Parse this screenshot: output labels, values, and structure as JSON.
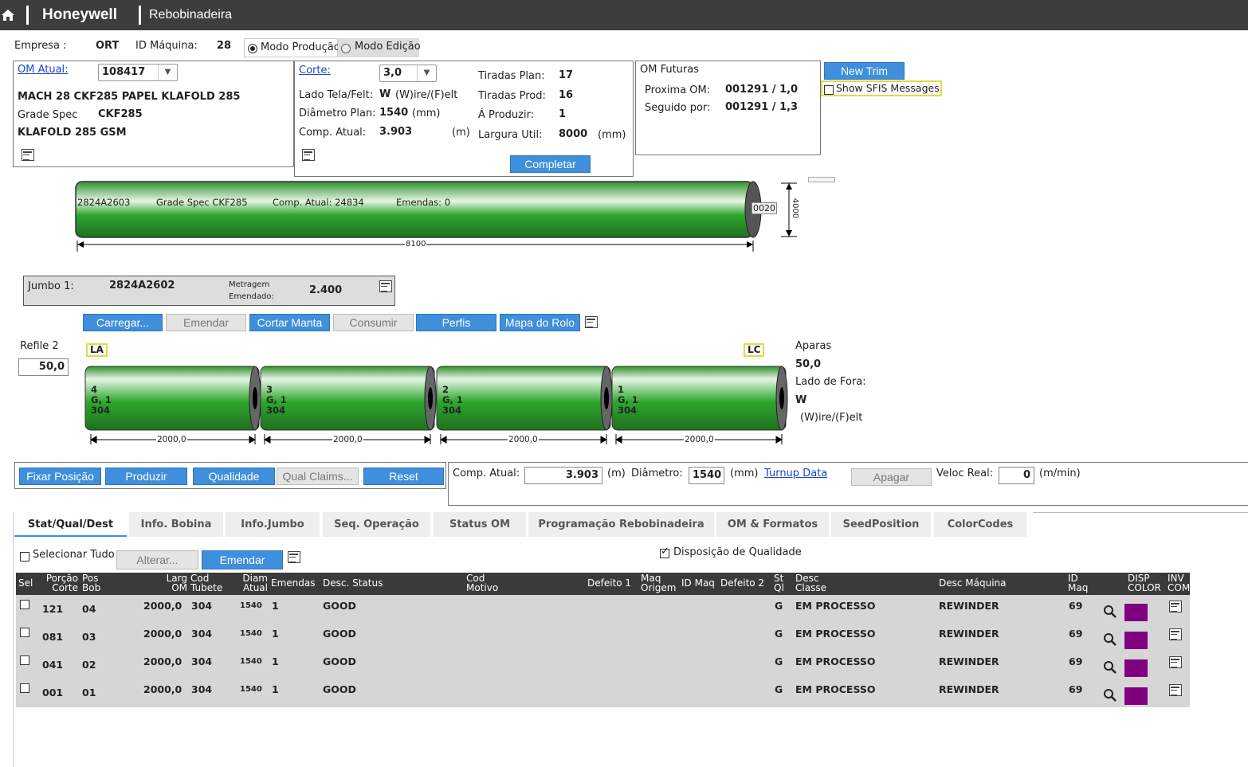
{
  "header": {
    "brand": "Honeywell",
    "app": "Rebobinadeira"
  },
  "info": {
    "empresa_label": "Empresa :",
    "empresa": "ORT",
    "maquina_label": "ID Máquina:",
    "maquina": "28",
    "modo_producao": "Modo Produção",
    "modo_edicao": "Modo Edição"
  },
  "om": {
    "label": "OM Atual:",
    "value": "108417",
    "line1": "MACH 28 CKF285 PAPEL KLAFOLD 285",
    "grade_label": "Grade Spec",
    "grade": "CKF285",
    "line3": "KLAFOLD 285 GSM"
  },
  "corte": {
    "label": "Corte:",
    "value": "3,0",
    "lado_label": "Lado Tela/Felt:",
    "lado": "W",
    "lado_hint": "(W)ire/(F)elt",
    "diam_label": "Diâmetro Plan:",
    "diam": "1540",
    "diam_unit": "(mm)",
    "comp_label": "Comp. Atual:",
    "comp": "3.903",
    "comp_unit": "(m)",
    "tir_plan_label": "Tiradas Plan:",
    "tir_plan": "17",
    "tir_prod_label": "Tiradas Prod:",
    "tir_prod": "16",
    "aprod_label": "Á Produzir:",
    "aprod": "1",
    "larg_label": "Largura Util:",
    "larg": "8000",
    "larg_unit": "(mm)",
    "completar": "Completar"
  },
  "futuras": {
    "title": "OM Futuras",
    "prox_label": "Proxima OM:",
    "prox": "001291 / 1,0",
    "seg_label": "Seguido por:",
    "seg": "001291 / 1,3"
  },
  "newtrim": "New Trim",
  "sfis": "Show SFIS Messages",
  "jumbo_roll": {
    "id": "2824A2603",
    "grade": "Grade Spec CKF285",
    "comp": "Comp. Atual: 24834",
    "emendas": "Emendas:  0",
    "end": "0020",
    "width": "8100",
    "height": "4000"
  },
  "jumbo1": {
    "label": "Jumbo 1:",
    "value": "2824A2602",
    "metragem": "Metragem",
    "emendado": "Emendado:",
    "mval": "2.400"
  },
  "actions": [
    "Carregar...",
    "Emendar",
    "Cortar Manta",
    "Consumir",
    "Perfis",
    "Mapa do Rolo"
  ],
  "refile": {
    "label": "Refile 2",
    "value": "50,0",
    "la": "LA",
    "lc": "LC"
  },
  "aparas": {
    "label": "Aparas",
    "value": "50,0",
    "lado_label": "Lado de Fora:",
    "lado": "W",
    "hint": "(W)ire/(F)elt"
  },
  "rolls": [
    {
      "n": "4",
      "g": "G, 1",
      "c": "304",
      "w": "2000,0"
    },
    {
      "n": "3",
      "g": "G, 1",
      "c": "304",
      "w": "2000,0"
    },
    {
      "n": "2",
      "g": "G, 1",
      "c": "304",
      "w": "2000,0"
    },
    {
      "n": "1",
      "g": "G, 1",
      "c": "304",
      "w": "2000,0"
    }
  ],
  "ops": [
    "Fixar Posição",
    "Produzir",
    "Qualidade",
    "Qual Claims...",
    "Reset"
  ],
  "status": {
    "comp_label": "Comp. Atual:",
    "comp": "3.903",
    "m": "(m)",
    "diam_label": "Diâmetro:",
    "diam": "1540",
    "mm": "(mm)",
    "turnup": "Turnup Data",
    "apagar": "Apagar",
    "veloc_label": "Veloc Real:",
    "veloc": "0",
    "unit": "(m/min)"
  },
  "tabs": [
    "Stat/Qual/Dest",
    "Info. Bobina",
    "Info.Jumbo",
    "Seq. Operação",
    "Status OM",
    "Programação Rebobinadeira",
    "OM & Formatos",
    "SeedPosition",
    "ColorCodes"
  ],
  "table_tools": {
    "select_all": "Selecionar Tudo",
    "alterar": "Alterar...",
    "emendar": "Emendar",
    "disposicao": "Disposição de Qualidade"
  },
  "table": {
    "headers": [
      "Sel",
      "Porção Corte",
      "Pos Bob",
      "Larg OM",
      "Cod Tubete",
      "Diam Atual",
      "Emendas",
      "Desc. Status",
      "Cod Motivo",
      "Defeito 1",
      "Maq Origem",
      "ID Maq",
      "Defeito 2",
      "St Ql",
      "Desc Classe",
      "Desc Máquina",
      "ID Maq",
      "DISP COLOR",
      "INV COM"
    ],
    "rows": [
      {
        "porcao": "121",
        "pos": "04",
        "larg": "2000,0",
        "tubete": "304",
        "diam": "1540",
        "emendas": "1",
        "status": "GOOD",
        "st": "G",
        "classe": "EM PROCESSO",
        "maquina": "REWINDER",
        "id": "69",
        "color": "#800080"
      },
      {
        "porcao": "081",
        "pos": "03",
        "larg": "2000,0",
        "tubete": "304",
        "diam": "1540",
        "emendas": "1",
        "status": "GOOD",
        "st": "G",
        "classe": "EM PROCESSO",
        "maquina": "REWINDER",
        "id": "69",
        "color": "#800080"
      },
      {
        "porcao": "041",
        "pos": "02",
        "larg": "2000,0",
        "tubete": "304",
        "diam": "1540",
        "emendas": "1",
        "status": "GOOD",
        "st": "G",
        "classe": "EM PROCESSO",
        "maquina": "REWINDER",
        "id": "69",
        "color": "#800080"
      },
      {
        "porcao": "001",
        "pos": "01",
        "larg": "2000,0",
        "tubete": "304",
        "diam": "1540",
        "emendas": "1",
        "status": "GOOD",
        "st": "G",
        "classe": "EM PROCESSO",
        "maquina": "REWINDER",
        "id": "69",
        "color": "#800080"
      }
    ]
  },
  "colors": {
    "accent": "#3f8fdc",
    "roll_green": "#2e9a2e",
    "header_bg": "#3d3d3d",
    "disp": "#800080"
  }
}
